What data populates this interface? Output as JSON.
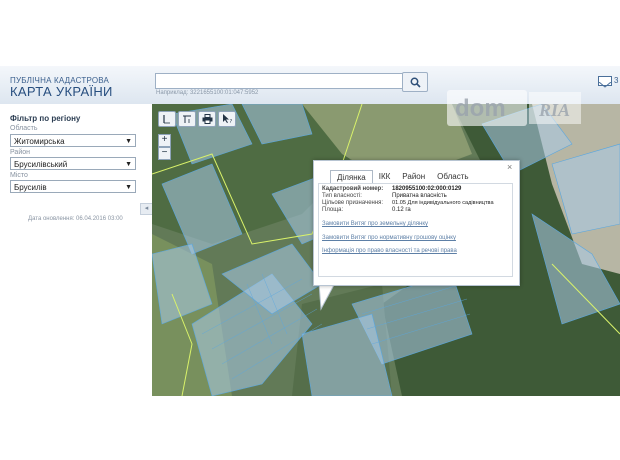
{
  "header": {
    "logo_line1": "ПУБЛІЧНА КАДАСТРОВА",
    "logo_line2": "КАРТА УКРАЇНИ",
    "search_value": "",
    "search_hint": "Наприклад: 3221655100:01:047:5952",
    "mail_count": "3"
  },
  "sidebar": {
    "title": "Фільтр по регіону",
    "oblast_label": "Область",
    "oblast_value": "Житомирська",
    "raion_label": "Район",
    "raion_value": "Брусилівський",
    "misto_label": "Місто",
    "misto_value": "Брусилів",
    "collapse": "◂",
    "update_date": "Дата оновлення: 06.04.2016 03:00"
  },
  "map": {
    "zoom_in": "+",
    "zoom_out": "−"
  },
  "popup": {
    "tabs": [
      "Ділянка",
      "ІКК",
      "Район",
      "Область"
    ],
    "active_tab": "Ділянка",
    "close": "×",
    "fields": [
      {
        "label": "Кадастровий номер:",
        "value": "1820955100:02:000:0129"
      },
      {
        "label": "Тип власності:",
        "value": "Приватна власність"
      },
      {
        "label": "Цільове призначення:",
        "value": "01.05 Для індивідуального садівництва"
      },
      {
        "label": "Площа:",
        "value": "0.12 га"
      }
    ],
    "links": [
      "Замовити Витяг про земельну ділянку",
      "Замовити Витяг про нормативну грошову оцінку",
      "Інформація про право власності та речові права"
    ]
  },
  "watermark": {
    "text1": "dom",
    "text2": "RIA"
  }
}
